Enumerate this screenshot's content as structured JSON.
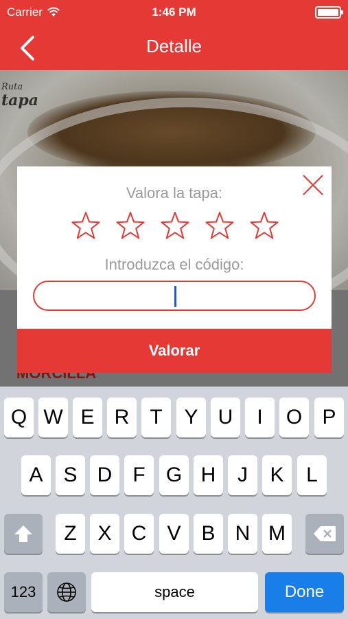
{
  "status_bar": {
    "carrier": "Carrier",
    "time": "1:46 PM"
  },
  "nav": {
    "title": "Detalle",
    "back_icon": "chevron-left-icon"
  },
  "photo": {
    "logo_line1": "Ruta",
    "logo_line2": "tapa"
  },
  "dish": {
    "name": "MORCILLA"
  },
  "dialog": {
    "rate_label": "Valora la tapa:",
    "stars_total": 5,
    "stars_selected": 0,
    "code_label": "Introduzca el código:",
    "code_value": "",
    "submit_label": "Valorar",
    "close_icon": "close-icon",
    "accent": "#e53935"
  },
  "keyboard": {
    "row1": [
      "Q",
      "W",
      "E",
      "R",
      "T",
      "Y",
      "U",
      "I",
      "O",
      "P"
    ],
    "row2": [
      "A",
      "S",
      "D",
      "F",
      "G",
      "H",
      "J",
      "K",
      "L"
    ],
    "row3": [
      "Z",
      "X",
      "C",
      "V",
      "B",
      "N",
      "M"
    ],
    "shift_icon": "shift-icon",
    "delete_icon": "backspace-icon",
    "numbers_label": "123",
    "globe_icon": "globe-icon",
    "space_label": "space",
    "done_label": "Done",
    "done_color": "#1a7ee8"
  }
}
